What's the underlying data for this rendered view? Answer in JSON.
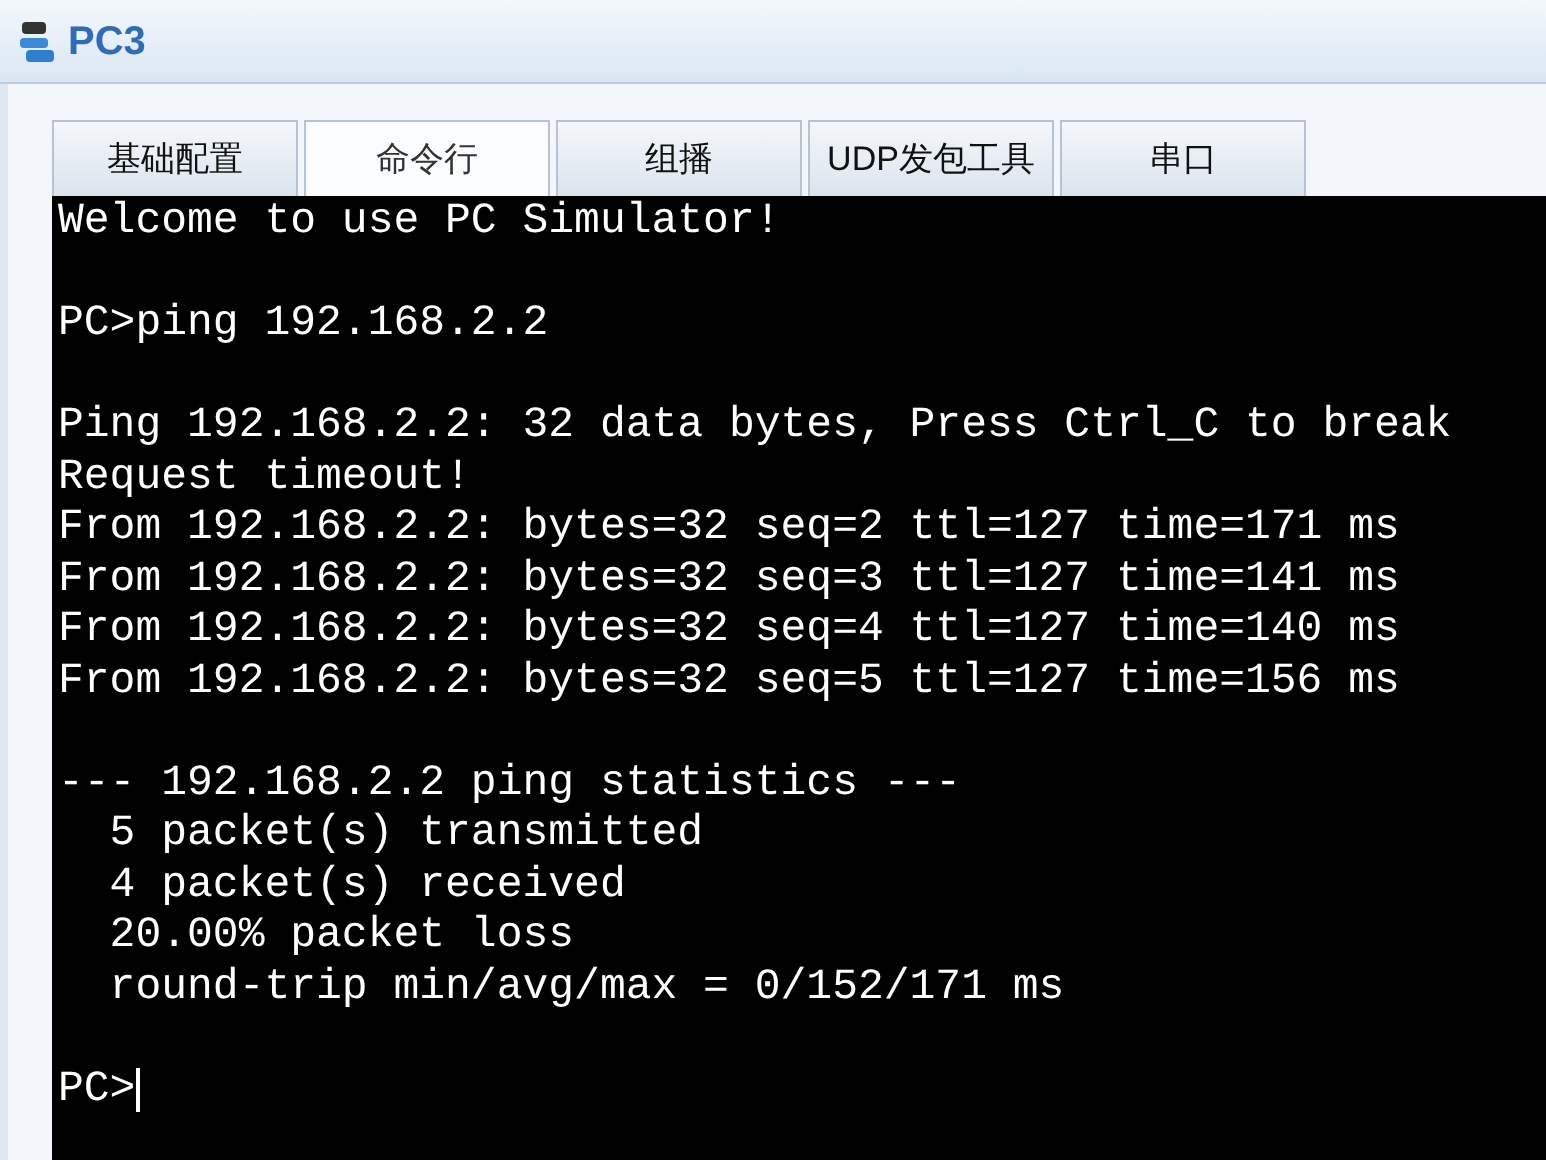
{
  "window": {
    "title": "PC3"
  },
  "tabs": [
    {
      "label": "基础配置",
      "selected": false
    },
    {
      "label": "命令行",
      "selected": true
    },
    {
      "label": "组播",
      "selected": false
    },
    {
      "label": "UDP发包工具",
      "selected": false
    },
    {
      "label": "串口",
      "selected": false
    }
  ],
  "terminal": {
    "blocks": [
      [
        "Welcome to use PC Simulator!"
      ],
      [
        "PC>ping 192.168.2.2"
      ],
      [
        "Ping 192.168.2.2: 32 data bytes, Press Ctrl_C to break",
        "Request timeout!",
        "From 192.168.2.2: bytes=32 seq=2 ttl=127 time=171 ms",
        "From 192.168.2.2: bytes=32 seq=3 ttl=127 time=141 ms",
        "From 192.168.2.2: bytes=32 seq=4 ttl=127 time=140 ms",
        "From 192.168.2.2: bytes=32 seq=5 ttl=127 time=156 ms"
      ],
      [
        "--- 192.168.2.2 ping statistics ---",
        "  5 packet(s) transmitted",
        "  4 packet(s) received",
        "  20.00% packet loss",
        "  round-trip min/avg/max = 0/152/171 ms"
      ]
    ],
    "prompt": "PC>"
  }
}
